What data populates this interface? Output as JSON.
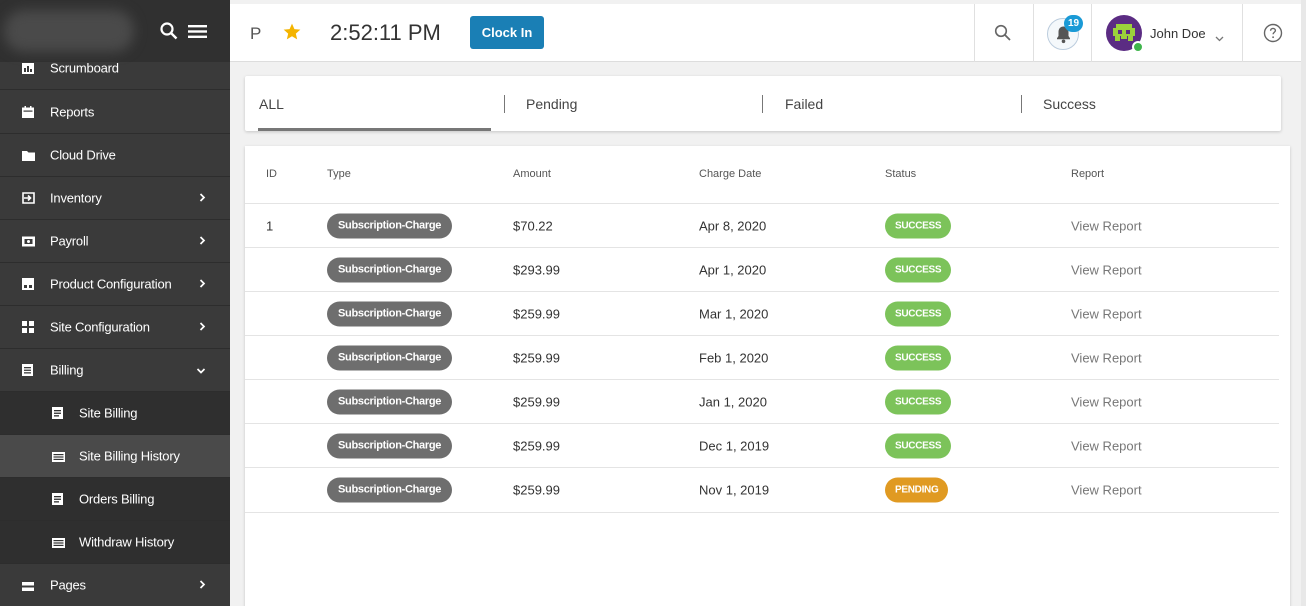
{
  "sidebar": {
    "items": [
      {
        "label": "Scrumboard",
        "icon": "scrumboard-icon",
        "chevron": ""
      },
      {
        "label": "Reports",
        "icon": "calendar-icon",
        "chevron": ""
      },
      {
        "label": "Cloud Drive",
        "icon": "folder-icon",
        "chevron": ""
      },
      {
        "label": "Inventory",
        "icon": "inventory-icon",
        "chevron": "›"
      },
      {
        "label": "Payroll",
        "icon": "payroll-icon",
        "chevron": "›"
      },
      {
        "label": "Product Configuration",
        "icon": "product-icon",
        "chevron": "›"
      },
      {
        "label": "Site Configuration",
        "icon": "site-config-icon",
        "chevron": "›"
      },
      {
        "label": "Billing",
        "icon": "billing-icon",
        "chevron": "⌄"
      }
    ],
    "sub_items": [
      {
        "label": "Site Billing",
        "icon": "document-icon"
      },
      {
        "label": "Site Billing History",
        "icon": "list-icon"
      },
      {
        "label": "Orders Billing",
        "icon": "document-icon"
      },
      {
        "label": "Withdraw History",
        "icon": "list-icon"
      }
    ],
    "pages": {
      "label": "Pages",
      "icon": "pages-icon",
      "chevron": "›"
    }
  },
  "topbar": {
    "initial": "P",
    "time": "2:52:11 PM",
    "clock_in_label": "Clock In",
    "notification_count": "19",
    "user_name": "John Doe"
  },
  "tabs": [
    {
      "label": "ALL"
    },
    {
      "label": "Pending"
    },
    {
      "label": "Failed"
    },
    {
      "label": "Success"
    }
  ],
  "table": {
    "headers": {
      "id": "ID",
      "type": "Type",
      "amount": "Amount",
      "charge_date": "Charge Date",
      "status": "Status",
      "report": "Report"
    },
    "rows": [
      {
        "id": "1",
        "type": "Subscription-Charge",
        "amount": "$70.22",
        "date": "Apr 8, 2020",
        "status": "SUCCESS",
        "report": "View Report"
      },
      {
        "id": "",
        "type": "Subscription-Charge",
        "amount": "$293.99",
        "date": "Apr 1, 2020",
        "status": "SUCCESS",
        "report": "View Report"
      },
      {
        "id": "",
        "type": "Subscription-Charge",
        "amount": "$259.99",
        "date": "Mar 1, 2020",
        "status": "SUCCESS",
        "report": "View Report"
      },
      {
        "id": "",
        "type": "Subscription-Charge",
        "amount": "$259.99",
        "date": "Feb 1, 2020",
        "status": "SUCCESS",
        "report": "View Report"
      },
      {
        "id": "",
        "type": "Subscription-Charge",
        "amount": "$259.99",
        "date": "Jan 1, 2020",
        "status": "SUCCESS",
        "report": "View Report"
      },
      {
        "id": "",
        "type": "Subscription-Charge",
        "amount": "$259.99",
        "date": "Dec 1, 2019",
        "status": "SUCCESS",
        "report": "View Report"
      },
      {
        "id": "",
        "type": "Subscription-Charge",
        "amount": "$259.99",
        "date": "Nov 1, 2019",
        "status": "PENDING",
        "report": "View Report"
      }
    ]
  },
  "colors": {
    "success": "#7cc35a",
    "pending": "#e09a22",
    "primary": "#1a7fb5",
    "sidebar_bg": "#3a3a3a"
  }
}
